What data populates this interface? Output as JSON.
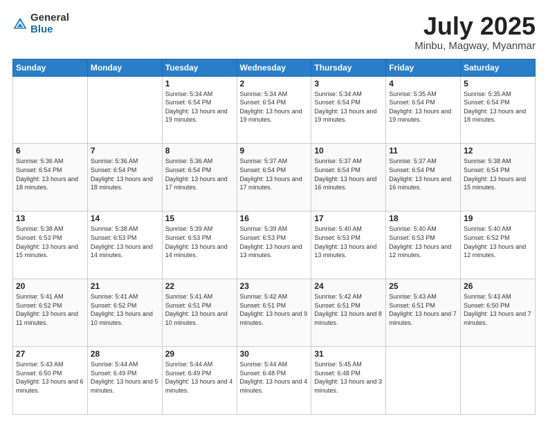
{
  "logo": {
    "general": "General",
    "blue": "Blue"
  },
  "title": {
    "month": "July 2025",
    "location": "Minbu, Magway, Myanmar"
  },
  "weekdays": [
    "Sunday",
    "Monday",
    "Tuesday",
    "Wednesday",
    "Thursday",
    "Friday",
    "Saturday"
  ],
  "weeks": [
    [
      {
        "day": "",
        "content": ""
      },
      {
        "day": "",
        "content": ""
      },
      {
        "day": "1",
        "content": "Sunrise: 5:34 AM\nSunset: 6:54 PM\nDaylight: 13 hours and 19 minutes."
      },
      {
        "day": "2",
        "content": "Sunrise: 5:34 AM\nSunset: 6:54 PM\nDaylight: 13 hours and 19 minutes."
      },
      {
        "day": "3",
        "content": "Sunrise: 5:34 AM\nSunset: 6:54 PM\nDaylight: 13 hours and 19 minutes."
      },
      {
        "day": "4",
        "content": "Sunrise: 5:35 AM\nSunset: 6:54 PM\nDaylight: 13 hours and 19 minutes."
      },
      {
        "day": "5",
        "content": "Sunrise: 5:35 AM\nSunset: 6:54 PM\nDaylight: 13 hours and 18 minutes."
      }
    ],
    [
      {
        "day": "6",
        "content": "Sunrise: 5:36 AM\nSunset: 6:54 PM\nDaylight: 13 hours and 18 minutes."
      },
      {
        "day": "7",
        "content": "Sunrise: 5:36 AM\nSunset: 6:54 PM\nDaylight: 13 hours and 18 minutes."
      },
      {
        "day": "8",
        "content": "Sunrise: 5:36 AM\nSunset: 6:54 PM\nDaylight: 13 hours and 17 minutes."
      },
      {
        "day": "9",
        "content": "Sunrise: 5:37 AM\nSunset: 6:54 PM\nDaylight: 13 hours and 17 minutes."
      },
      {
        "day": "10",
        "content": "Sunrise: 5:37 AM\nSunset: 6:54 PM\nDaylight: 13 hours and 16 minutes."
      },
      {
        "day": "11",
        "content": "Sunrise: 5:37 AM\nSunset: 6:54 PM\nDaylight: 13 hours and 16 minutes."
      },
      {
        "day": "12",
        "content": "Sunrise: 5:38 AM\nSunset: 6:54 PM\nDaylight: 13 hours and 15 minutes."
      }
    ],
    [
      {
        "day": "13",
        "content": "Sunrise: 5:38 AM\nSunset: 6:53 PM\nDaylight: 13 hours and 15 minutes."
      },
      {
        "day": "14",
        "content": "Sunrise: 5:38 AM\nSunset: 6:53 PM\nDaylight: 13 hours and 14 minutes."
      },
      {
        "day": "15",
        "content": "Sunrise: 5:39 AM\nSunset: 6:53 PM\nDaylight: 13 hours and 14 minutes."
      },
      {
        "day": "16",
        "content": "Sunrise: 5:39 AM\nSunset: 6:53 PM\nDaylight: 13 hours and 13 minutes."
      },
      {
        "day": "17",
        "content": "Sunrise: 5:40 AM\nSunset: 6:53 PM\nDaylight: 13 hours and 13 minutes."
      },
      {
        "day": "18",
        "content": "Sunrise: 5:40 AM\nSunset: 6:53 PM\nDaylight: 13 hours and 12 minutes."
      },
      {
        "day": "19",
        "content": "Sunrise: 5:40 AM\nSunset: 6:52 PM\nDaylight: 13 hours and 12 minutes."
      }
    ],
    [
      {
        "day": "20",
        "content": "Sunrise: 5:41 AM\nSunset: 6:52 PM\nDaylight: 13 hours and 11 minutes."
      },
      {
        "day": "21",
        "content": "Sunrise: 5:41 AM\nSunset: 6:52 PM\nDaylight: 13 hours and 10 minutes."
      },
      {
        "day": "22",
        "content": "Sunrise: 5:41 AM\nSunset: 6:51 PM\nDaylight: 13 hours and 10 minutes."
      },
      {
        "day": "23",
        "content": "Sunrise: 5:42 AM\nSunset: 6:51 PM\nDaylight: 13 hours and 9 minutes."
      },
      {
        "day": "24",
        "content": "Sunrise: 5:42 AM\nSunset: 6:51 PM\nDaylight: 13 hours and 8 minutes."
      },
      {
        "day": "25",
        "content": "Sunrise: 5:43 AM\nSunset: 6:51 PM\nDaylight: 13 hours and 7 minutes."
      },
      {
        "day": "26",
        "content": "Sunrise: 5:43 AM\nSunset: 6:50 PM\nDaylight: 13 hours and 7 minutes."
      }
    ],
    [
      {
        "day": "27",
        "content": "Sunrise: 5:43 AM\nSunset: 6:50 PM\nDaylight: 13 hours and 6 minutes."
      },
      {
        "day": "28",
        "content": "Sunrise: 5:44 AM\nSunset: 6:49 PM\nDaylight: 13 hours and 5 minutes."
      },
      {
        "day": "29",
        "content": "Sunrise: 5:44 AM\nSunset: 6:49 PM\nDaylight: 13 hours and 4 minutes."
      },
      {
        "day": "30",
        "content": "Sunrise: 5:44 AM\nSunset: 6:48 PM\nDaylight: 13 hours and 4 minutes."
      },
      {
        "day": "31",
        "content": "Sunrise: 5:45 AM\nSunset: 6:48 PM\nDaylight: 13 hours and 3 minutes."
      },
      {
        "day": "",
        "content": ""
      },
      {
        "day": "",
        "content": ""
      }
    ]
  ]
}
